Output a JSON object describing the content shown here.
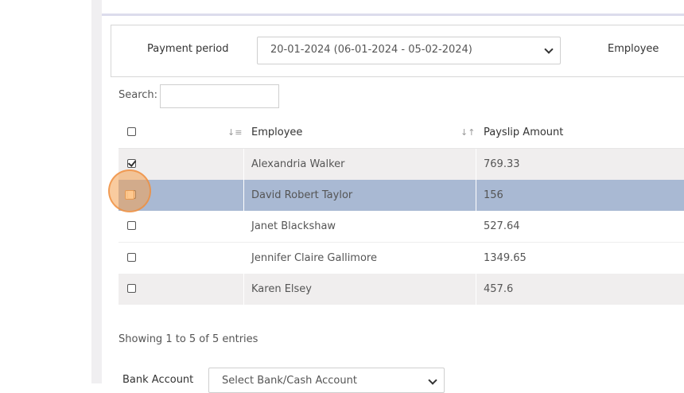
{
  "filter": {
    "period_label": "Payment period",
    "period_value": "20-01-2024 (06-01-2024 - 05-02-2024)",
    "employee_label": "Employee"
  },
  "search": {
    "label": "Search:",
    "value": ""
  },
  "table": {
    "headers": {
      "employee": "Employee",
      "amount": "Payslip Amount"
    },
    "rows": [
      {
        "employee": "Alexandria Walker",
        "amount": "769.33",
        "checked": true
      },
      {
        "employee": "David Robert Taylor",
        "amount": "156",
        "checked": false,
        "highlighted": true
      },
      {
        "employee": "Janet Blackshaw",
        "amount": "527.64",
        "checked": false
      },
      {
        "employee": "Jennifer Claire Gallimore",
        "amount": "1349.65",
        "checked": false
      },
      {
        "employee": "Karen Elsey",
        "amount": "457.6",
        "checked": false
      }
    ]
  },
  "info": "Showing 1 to 5 of 5 entries",
  "bank": {
    "label": "Bank Account",
    "placeholder": "Select Bank/Cash Account"
  },
  "colors": {
    "highlight_row": "#a9b9d3",
    "click_marker": "#f4a050"
  }
}
